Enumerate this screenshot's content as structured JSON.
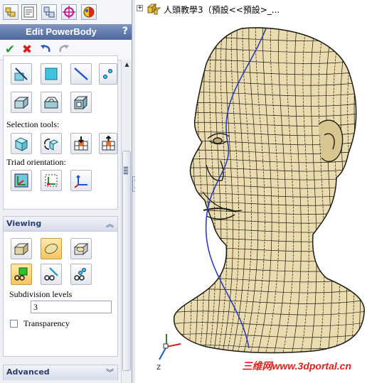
{
  "window": {
    "panel_tabs": [
      "feature-manager-tab",
      "property-manager-tab",
      "configuration-manager-tab",
      "dimxpert-tab",
      "display-manager-tab"
    ]
  },
  "panel": {
    "title": "Edit PowerBody",
    "help": "?",
    "actions": [
      "ok",
      "cancel",
      "undo",
      "redo"
    ]
  },
  "tools": {
    "selection_label": "Selection tools:",
    "triad_label": "Triad orientation:"
  },
  "viewing": {
    "title": "Viewing",
    "subdivision_label": "Subdivision levels",
    "subdivision_value": "3",
    "transparency_label": "Transparency",
    "transparency_checked": false
  },
  "advanced": {
    "title": "Advanced"
  },
  "tree": {
    "expand": "+",
    "label": "人頭教學3（預設<<預設>_..."
  },
  "watermark": "三维网www.3dportal.cn",
  "colors": {
    "title_bar": "#5a72a6",
    "mesh_fill": "#eadcae",
    "mesh_lines": "#1b1a14",
    "accent_blue": "#2b3db8",
    "ok_green": "#1f9a2c",
    "cancel_red": "#d61e1e"
  }
}
